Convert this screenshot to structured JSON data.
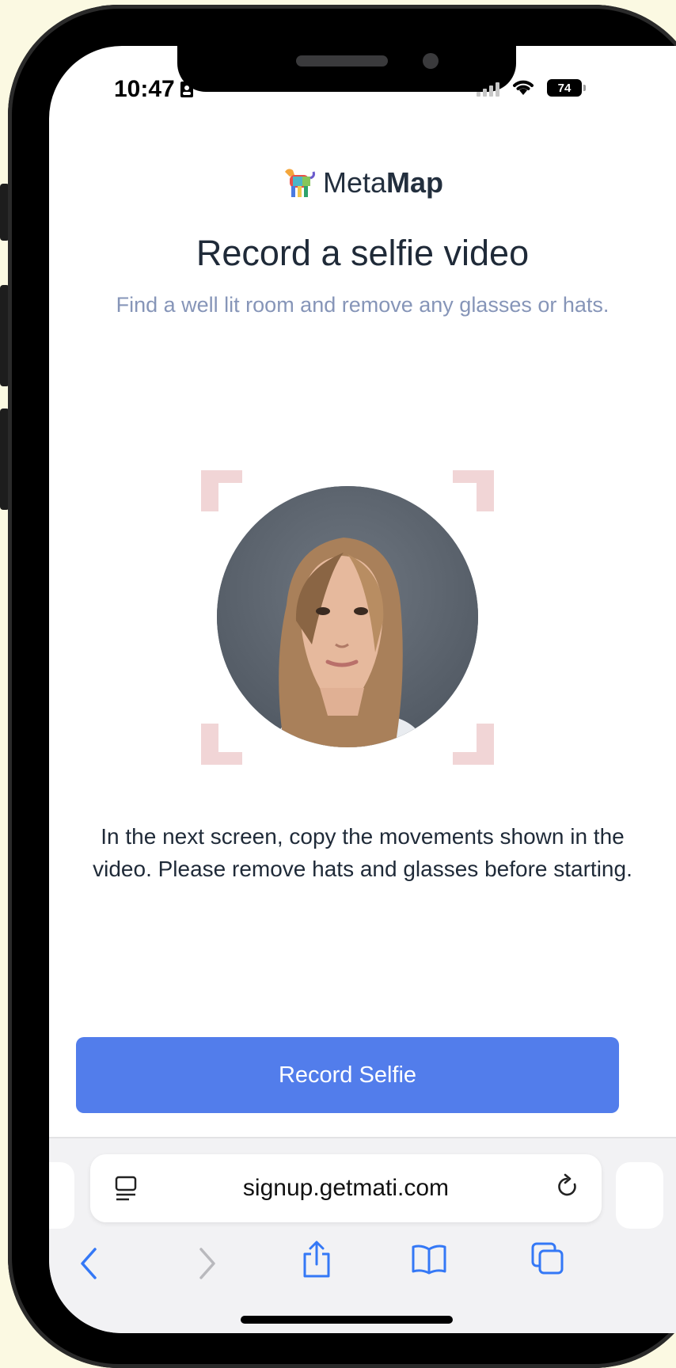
{
  "status_bar": {
    "time": "10:47",
    "battery": "74"
  },
  "brand": {
    "name_light": "Meta",
    "name_bold": "Map"
  },
  "header": {
    "title": "Record a selfie video",
    "subtitle": "Find a well lit room and remove any glasses or hats."
  },
  "instructions": "In the next screen, copy the movements shown in the video. Please remove hats and glasses before starting.",
  "primary_button": {
    "label": "Record Selfie"
  },
  "browser": {
    "url": "signup.getmati.com"
  },
  "colors": {
    "accent": "#527deb",
    "frame": "#f1d5d6",
    "subtitle": "#8695b8",
    "title": "#1f2a38"
  }
}
